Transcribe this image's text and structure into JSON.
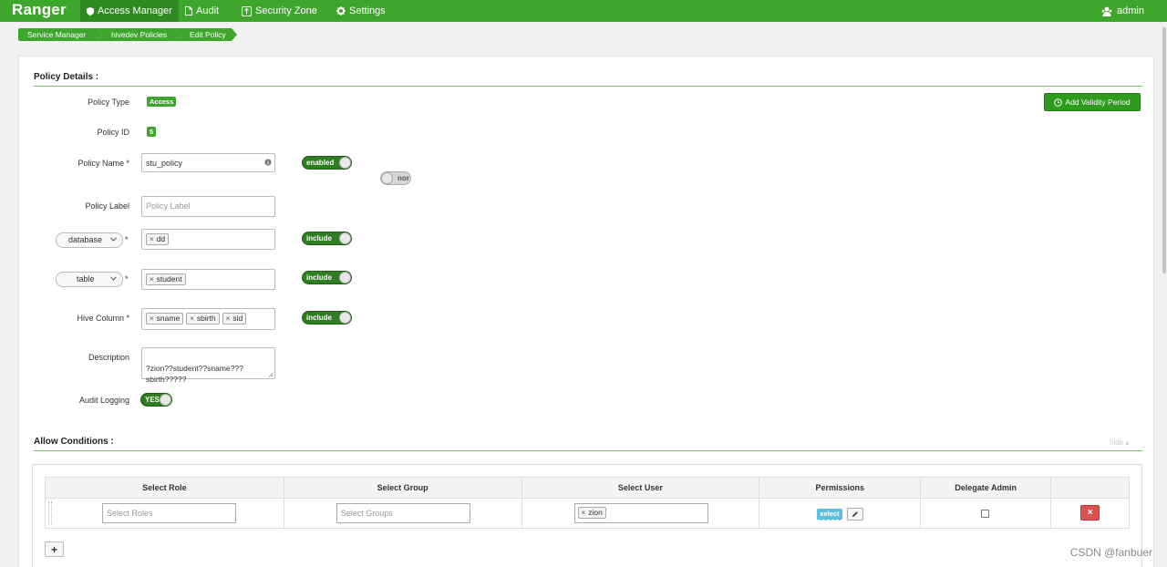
{
  "navbar": {
    "brand": "Ranger",
    "items": [
      {
        "label": "Access Manager",
        "icon": "shield-icon",
        "active": true
      },
      {
        "label": "Audit",
        "icon": "file-icon",
        "active": false
      },
      {
        "label": "Security Zone",
        "icon": "zone-icon",
        "active": false
      },
      {
        "label": "Settings",
        "icon": "gear-icon",
        "active": false
      }
    ],
    "user": {
      "label": "admin",
      "icon": "users-icon"
    }
  },
  "breadcrumb": [
    "Service Manager",
    "hivedev Policies",
    "Edit Policy"
  ],
  "policy_details": {
    "section_title": "Policy Details :",
    "policy_type": {
      "label": "Policy Type",
      "value": "Access"
    },
    "policy_id": {
      "label": "Policy ID",
      "value": "5"
    },
    "add_validity_button": "Add Validity Period",
    "policy_name": {
      "label": "Policy Name *",
      "value": "stu_policy",
      "toggle": "enabled",
      "secondary_toggle": "nor"
    },
    "policy_label": {
      "label": "Policy Label",
      "placeholder": "Policy Label"
    },
    "resources": [
      {
        "selector": "database",
        "required_mark": "*",
        "tags": [
          "dd"
        ],
        "toggle": "include"
      },
      {
        "selector": "table",
        "required_mark": "*",
        "tags": [
          "student"
        ],
        "toggle": "include"
      },
      {
        "label": "Hive Column *",
        "tags": [
          "sname",
          "sbirth",
          "sid"
        ],
        "toggle": "include"
      }
    ],
    "description": {
      "label": "Description",
      "value": "?zion??student??sname???\nsbirth?????"
    },
    "audit_logging": {
      "label": "Audit Logging",
      "toggle": "YES"
    }
  },
  "allow_conditions": {
    "section_title": "Allow Conditions :",
    "hide_link": "hide",
    "columns": [
      "Select Role",
      "Select Group",
      "Select User",
      "Permissions",
      "Delegate Admin",
      ""
    ],
    "rows": [
      {
        "role_placeholder": "Select Roles",
        "group_placeholder": "Select Groups",
        "users": [
          "zion"
        ],
        "permission": "select",
        "delegate_admin": false
      }
    ],
    "add_label": "+",
    "delete_label": "×"
  },
  "watermark": "CSDN @fanbuer",
  "colors": {
    "brand_green": "#3fa62d",
    "toggle_green": "#2e7d21",
    "danger": "#d9534f",
    "info": "#5bc0de"
  }
}
